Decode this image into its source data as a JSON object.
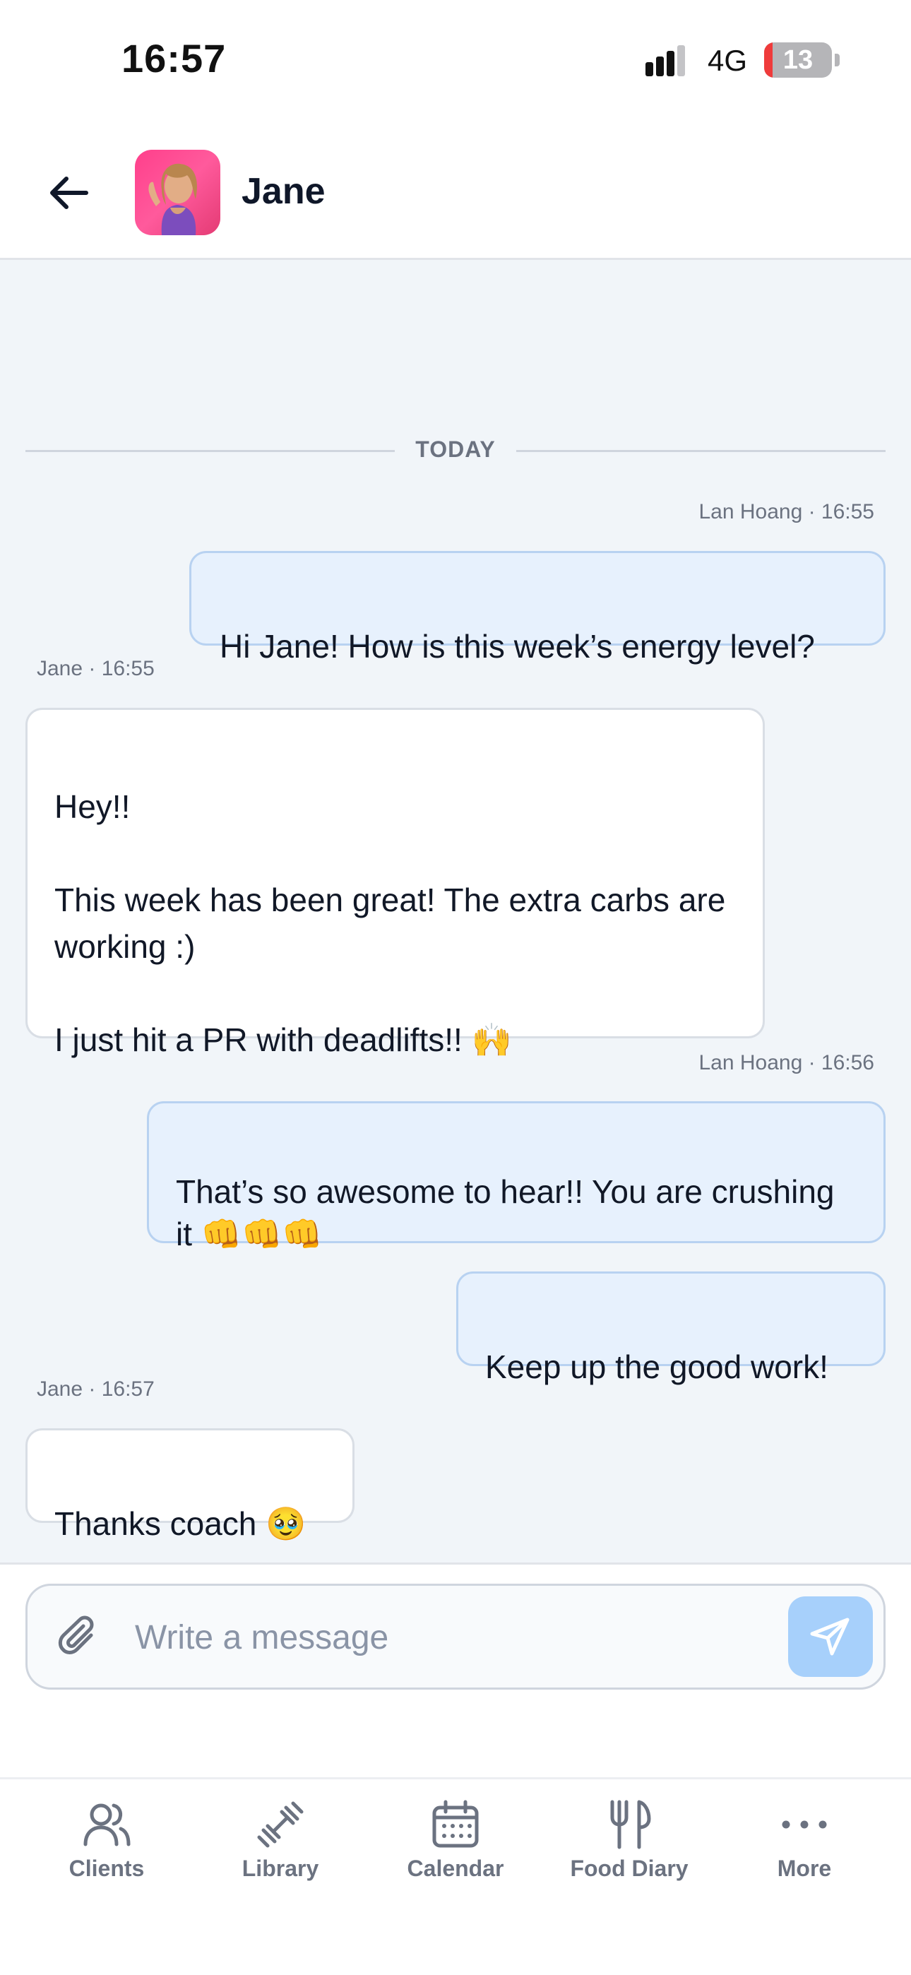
{
  "status_bar": {
    "time": "16:57",
    "network": "4G",
    "battery_level": "13",
    "battery_fraction": 0.13,
    "battery_color": "#ef3b3b"
  },
  "header": {
    "back_icon": "arrow-left-icon",
    "contact_name": "Jane"
  },
  "chat": {
    "date_divider": "TODAY",
    "messages": [
      {
        "direction": "outgoing",
        "meta": "Lan Hoang · 16:55",
        "text": "Hi Jane! How is this week’s energy level?"
      },
      {
        "direction": "incoming",
        "meta": "Jane · 16:55",
        "text": "Hey!!\n\nThis week has been great! The extra carbs are working :)\n\nI just hit a PR with deadlifts!! 🙌"
      },
      {
        "direction": "outgoing",
        "meta": "Lan Hoang · 16:56",
        "text": "That’s so awesome to hear!! You are crushing it 👊👊👊"
      },
      {
        "direction": "outgoing",
        "meta": "",
        "text": "Keep up the good work!"
      },
      {
        "direction": "incoming",
        "meta": "Jane · 16:57",
        "text": "Thanks coach 🥹"
      }
    ]
  },
  "composer": {
    "placeholder": "Write a message",
    "value": "",
    "attach_icon": "paperclip-icon",
    "send_icon": "send-icon",
    "send_color": "#a7d0fb"
  },
  "tabbar": {
    "items": [
      {
        "label": "Clients",
        "icon": "users-icon"
      },
      {
        "label": "Library",
        "icon": "dumbbell-icon"
      },
      {
        "label": "Calendar",
        "icon": "calendar-icon"
      },
      {
        "label": "Food Diary",
        "icon": "fork-knife-icon"
      },
      {
        "label": "More",
        "icon": "more-dots-icon"
      }
    ]
  },
  "colors": {
    "accent": "#2563eb",
    "outgoing_bubble": "#e7f1fd",
    "incoming_bubble": "#ffffff",
    "chat_background": "#f1f5f9"
  }
}
